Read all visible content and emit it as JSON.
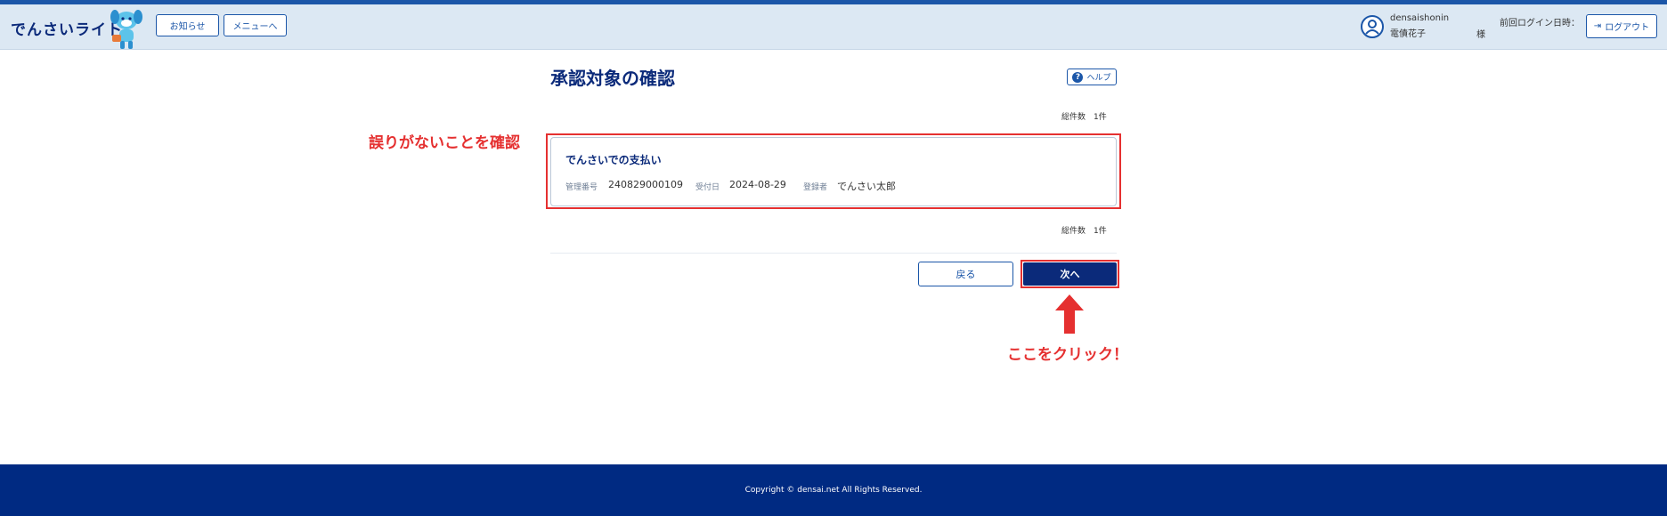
{
  "header": {
    "logo_text": "でんさいライト",
    "notice_button": "お知らせ",
    "menu_button": "メニューへ",
    "user_id": "densaishonin",
    "user_name": "電債花子",
    "honorific": "様",
    "last_login_label": "前回ログイン日時：",
    "logout_button": "ログアウト"
  },
  "page": {
    "title": "承認対象の確認",
    "help_button": "ヘルプ",
    "help_icon": "?",
    "total_count_top": "総件数　1件",
    "total_count_bottom": "総件数　1件"
  },
  "record": {
    "title": "でんさいでの支払い",
    "ref_label": "管理番号",
    "ref_value": "240829000109",
    "date_label": "受付日",
    "date_value": "2024-08-29",
    "registrant_label": "登録者",
    "registrant_value": "でんさい太郎"
  },
  "actions": {
    "back_button": "戻る",
    "next_button": "次へ"
  },
  "annotations": {
    "confirm_text": "誤りがないことを確認",
    "click_text": "ここをクリック！"
  },
  "footer": {
    "copyright": "Copyright © densai.net All Rights Reserved."
  },
  "colors": {
    "brand": "#0b2a7a",
    "accent": "#1b56a8",
    "annotation": "#e53030",
    "header_bg": "#dce8f3",
    "footer_bg": "#002a82"
  },
  "icons": {
    "mascot": "mascot-dog-icon",
    "user": "user-circle-icon",
    "logout": "logout-icon",
    "help": "question-circle-icon",
    "arrow": "arrow-up-icon"
  }
}
